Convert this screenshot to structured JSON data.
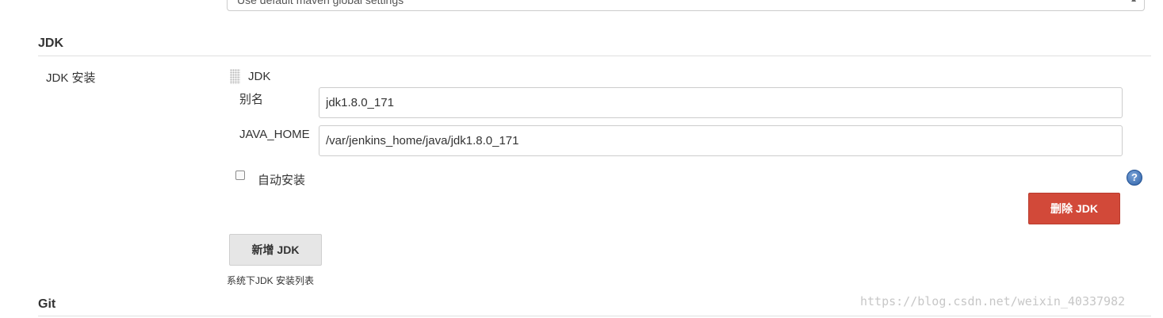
{
  "top_select": {
    "value": "Use default maven global settings"
  },
  "jdk_section": {
    "title": "JDK",
    "install_label": "JDK 安装",
    "item": {
      "header": "JDK",
      "alias_label": "别名",
      "alias_value": "jdk1.8.0_171",
      "java_home_label": "JAVA_HOME",
      "java_home_value": "/var/jenkins_home/java/jdk1.8.0_171",
      "auto_install_label": "自动安装",
      "auto_install_checked": false,
      "help_icon": "help-icon",
      "delete_button": "删除 JDK"
    },
    "add_button": "新增 JDK",
    "list_description": "系统下JDK 安装列表"
  },
  "git_section": {
    "title": "Git"
  },
  "watermark": "https://blog.csdn.net/weixin_40337982",
  "colors": {
    "delete_button": "#d24939",
    "add_button": "#e6e6e6",
    "help_icon": "#2f62a8",
    "rule": "#e0e0e0"
  }
}
